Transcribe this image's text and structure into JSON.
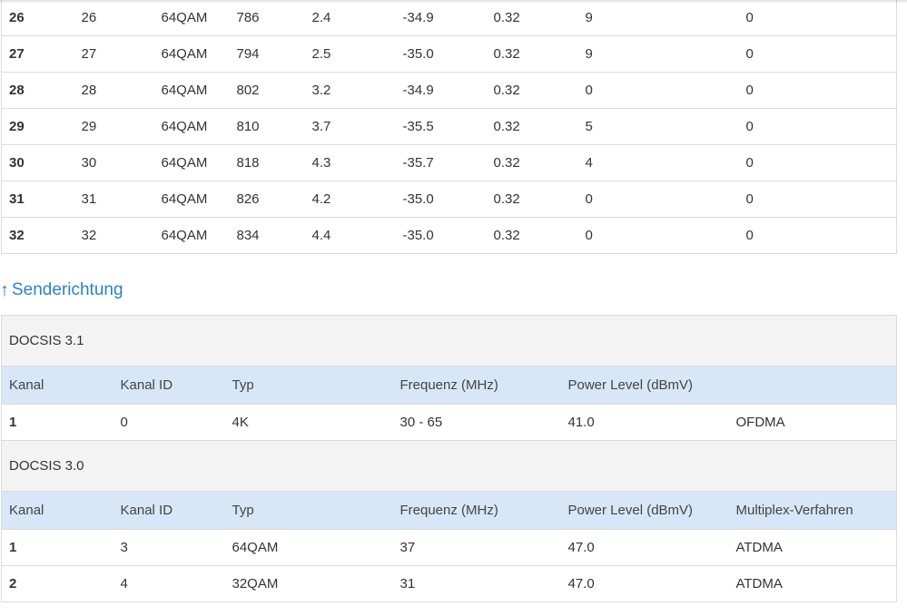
{
  "downstream_rows": [
    [
      "26",
      "26",
      "64QAM",
      "786",
      "2.4",
      "-34.9",
      "0.32",
      "9",
      "0"
    ],
    [
      "27",
      "27",
      "64QAM",
      "794",
      "2.5",
      "-35.0",
      "0.32",
      "9",
      "0"
    ],
    [
      "28",
      "28",
      "64QAM",
      "802",
      "3.2",
      "-34.9",
      "0.32",
      "0",
      "0"
    ],
    [
      "29",
      "29",
      "64QAM",
      "810",
      "3.7",
      "-35.5",
      "0.32",
      "5",
      "0"
    ],
    [
      "30",
      "30",
      "64QAM",
      "818",
      "4.3",
      "-35.7",
      "0.32",
      "4",
      "0"
    ],
    [
      "31",
      "31",
      "64QAM",
      "826",
      "4.2",
      "-35.0",
      "0.32",
      "0",
      "0"
    ],
    [
      "32",
      "32",
      "64QAM",
      "834",
      "4.4",
      "-35.0",
      "0.32",
      "0",
      "0"
    ]
  ],
  "upstream": {
    "heading_arrow": "↑",
    "heading": "Senderichtung",
    "docsis31": {
      "title": "DOCSIS 3.1",
      "headers": [
        "Kanal",
        "Kanal ID",
        "Typ",
        "Frequenz (MHz)",
        "Power Level (dBmV)",
        ""
      ],
      "rows": [
        [
          "1",
          "0",
          "4K",
          "30 - 65",
          "41.0",
          "OFDMA"
        ]
      ]
    },
    "docsis30": {
      "title": "DOCSIS 3.0",
      "headers": [
        "Kanal",
        "Kanal ID",
        "Typ",
        "Frequenz (MHz)",
        "Power Level (dBmV)",
        "Multiplex-Verfahren"
      ],
      "rows": [
        [
          "1",
          "3",
          "64QAM",
          "37",
          "47.0",
          "ATDMA"
        ],
        [
          "2",
          "4",
          "32QAM",
          "31",
          "47.0",
          "ATDMA"
        ]
      ]
    }
  }
}
